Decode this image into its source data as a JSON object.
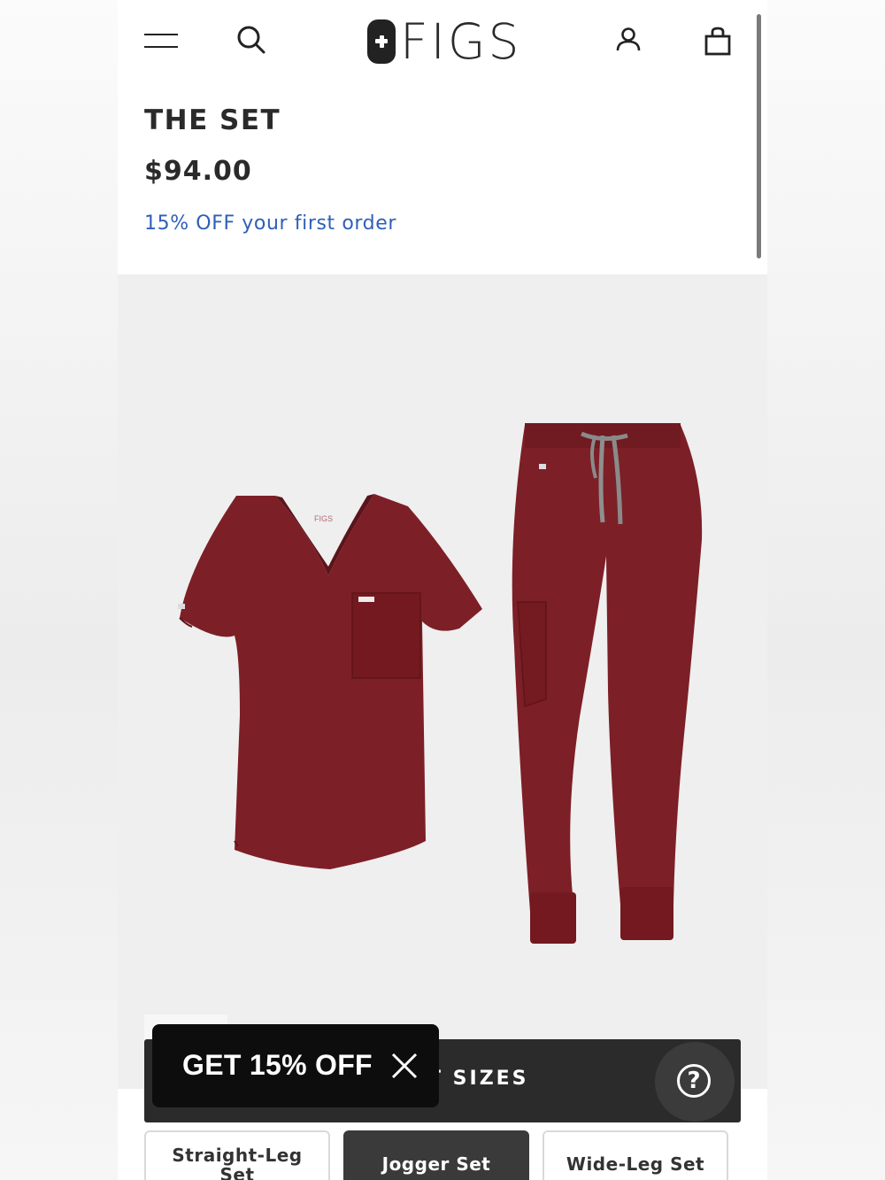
{
  "header": {
    "logo_text": "FIGS",
    "icons": [
      "menu-icon",
      "search-icon",
      "account-icon",
      "bag-icon"
    ]
  },
  "product": {
    "title": "THE SET",
    "price": "$94.00",
    "promo_text": "15% OFF your first order",
    "shirt_label": "FIGS"
  },
  "size_bar": {
    "label": "T SIZES"
  },
  "popup": {
    "text": "GET 15% OFF"
  },
  "set_options": [
    {
      "label_line1": "Straight-Leg",
      "label_line2": "Set",
      "selected": false
    },
    {
      "label_line1": "Jogger Set",
      "label_line2": "",
      "selected": true
    },
    {
      "label_line1": "Wide-Leg Set",
      "label_line2": "",
      "selected": false
    }
  ],
  "colors": {
    "garment": "#7d1f27",
    "promo_link": "#2f5fb8",
    "dark_bar": "#2b2b2b"
  }
}
